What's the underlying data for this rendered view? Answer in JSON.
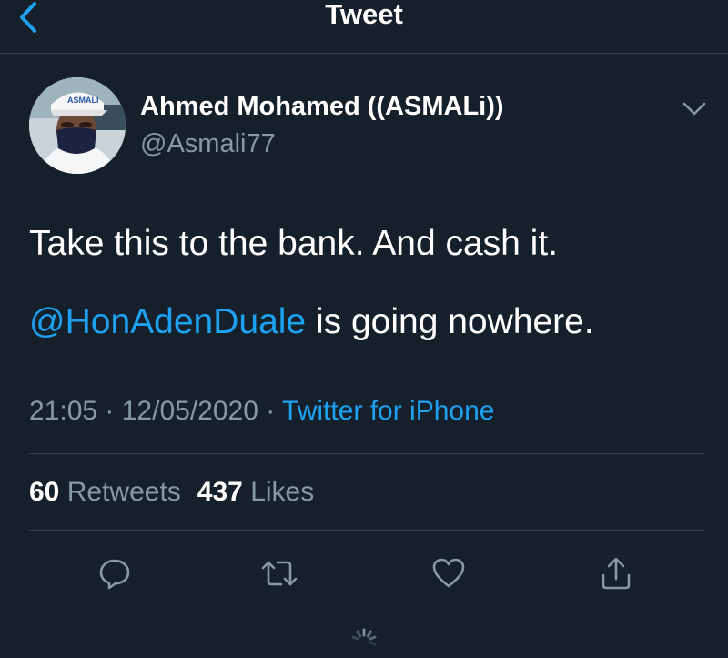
{
  "header": {
    "title": "Tweet",
    "back_icon": "chevron-left-icon"
  },
  "author": {
    "display_name": "Ahmed Mohamed ((ASMALi))",
    "handle": "@Asmali77",
    "cap_text": "ASMALI"
  },
  "tweet": {
    "line1": "Take this to the bank. And cash it.",
    "mention": "@HonAdenDuale",
    "line2_rest": " is going nowhere."
  },
  "meta": {
    "time": "21:05",
    "separator": " · ",
    "date": "12/05/2020",
    "source": "Twitter for iPhone"
  },
  "stats": {
    "retweets_count": "60",
    "retweets_label": "Retweets",
    "likes_count": "437",
    "likes_label": "Likes"
  },
  "actions": [
    "reply-icon",
    "retweet-icon",
    "like-icon",
    "share-icon"
  ],
  "colors": {
    "background": "#15202b",
    "accent": "#1da1f2",
    "muted": "#8899a6",
    "divider": "#38444d"
  }
}
